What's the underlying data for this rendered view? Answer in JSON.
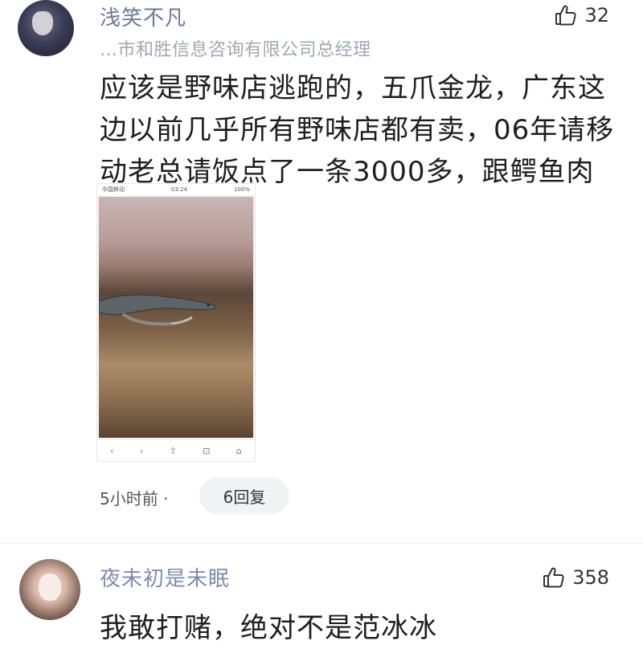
{
  "comments": [
    {
      "username": "浅笑不凡",
      "subtitle": "…市和胜信息咨询有限公司总经理",
      "likes": "32",
      "text": "应该是野味店逃跑的，五爪金龙，广东这边以前几乎所有野味店都有卖，06年请移动老总请饭点了一条3000多，跟鳄鱼肉差不多。",
      "time": "5小时前 ·",
      "reply_label": "6回复",
      "attachment": {
        "status_carrier": "中国移动",
        "status_time": "03:24",
        "status_battery": "100%",
        "nav_icons": [
          "‹",
          "›",
          "⇧",
          "⊡",
          "⌂"
        ]
      }
    },
    {
      "username": "夜未初是未眠",
      "likes": "358",
      "text": "我敢打赌，绝对不是范冰冰"
    }
  ],
  "icons": {
    "like": "thumbs-up-icon",
    "back": "chevron-left-icon",
    "forward": "chevron-right-icon",
    "share": "share-icon",
    "tabs": "tabs-icon",
    "home": "home-icon"
  },
  "colors": {
    "username": "#6a7a9a",
    "subtitle": "#a0a7b4",
    "reply_bg": "#f2f3f5"
  }
}
